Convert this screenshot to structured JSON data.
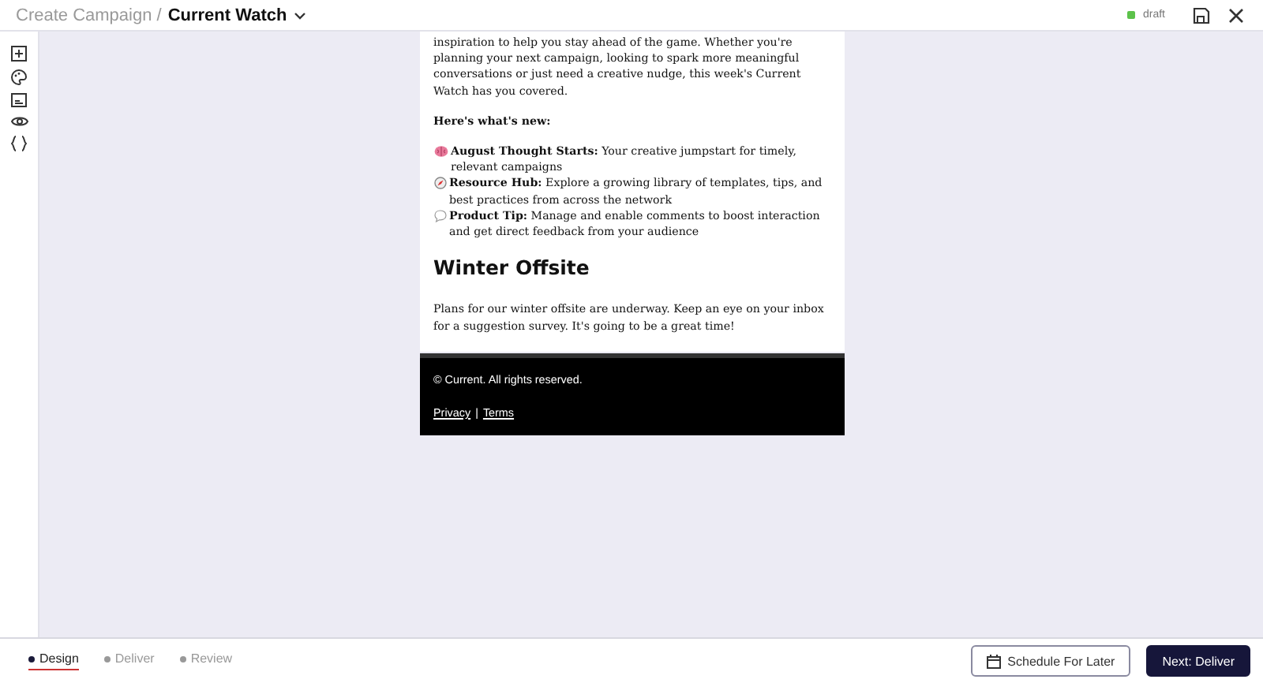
{
  "header": {
    "breadcrumb": "Create Campaign /",
    "title": "Current Watch",
    "status": "draft"
  },
  "email": {
    "intro": "inspiration to help you stay ahead of the game. Whether you're planning your next campaign, looking to spark more meaningful conversations or just need a creative nudge, this week's Current Watch has you covered.",
    "subheading": "Here's what's new:",
    "items": [
      {
        "kind": "brain",
        "text": "**August Thought Starts:** Your creative jumpstart for timely, relevant campaigns"
      },
      {
        "kind": "compass",
        "text": "**Resource Hub:** Explore a growing library of templates, tips, and best practices from across the network"
      },
      {
        "kind": "speech",
        "text": "**Product Tip:** Manage and enable comments to boost interaction and get direct feedback from your audience"
      }
    ],
    "section_title": "Winter Offsite",
    "section_text": "Plans for our winter offsite are underway. Keep an eye on your inbox for a suggestion survey. It's going to be a great time!",
    "copyright": "© Current. All rights reserved.",
    "links": [
      "Privacy",
      "Terms"
    ],
    "link_separator": "|"
  },
  "steps": [
    {
      "label": "Design",
      "selected": true
    },
    {
      "label": "Deliver",
      "selected": false
    },
    {
      "label": "Review",
      "selected": false
    }
  ],
  "buttons": {
    "secondary": "Schedule For Later",
    "primary": "Next: Deliver"
  }
}
